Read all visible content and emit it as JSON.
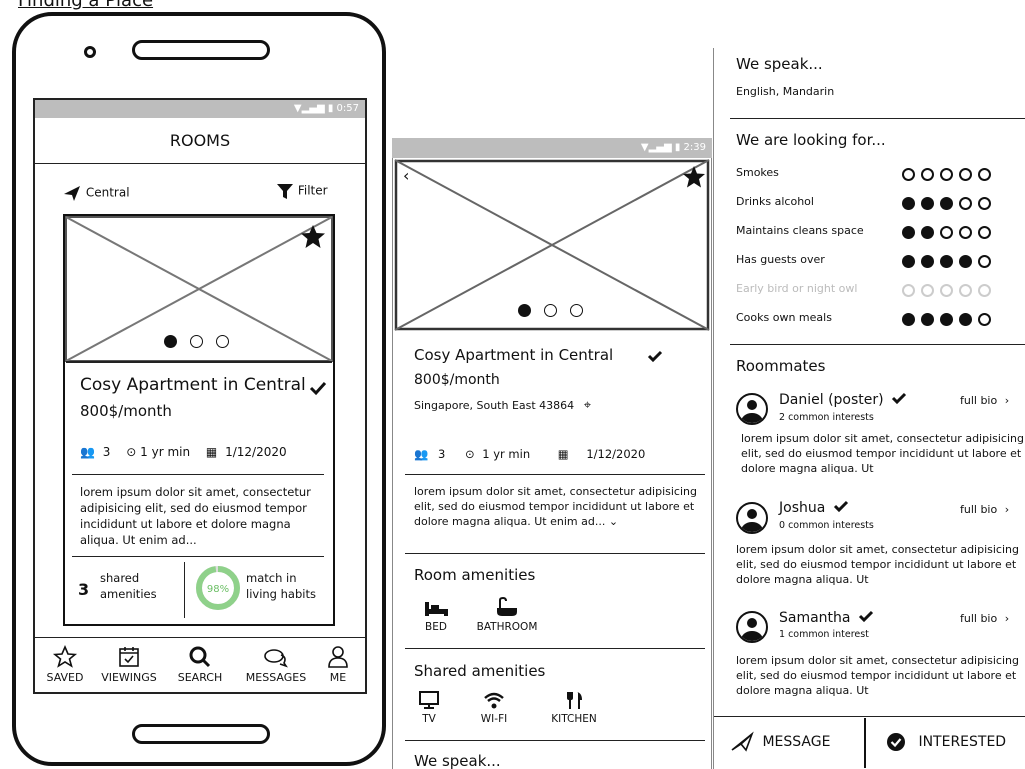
{
  "page_title": "Finding a Place",
  "phone1": {
    "status_time": "0:57",
    "header_title": "ROOMS",
    "location_label": "Central",
    "filter_label": "Filter",
    "card": {
      "title": "Cosy Apartment in Central",
      "price": "800$/month",
      "people": "3",
      "duration": "1 yr min",
      "date": "1/12/2020",
      "description": "lorem ipsum dolor sit amet, consectetur adipisicing elit, sed do eiusmod tempor incididunt ut labore et dolore magna aliqua. Ut enim ad...",
      "shared_count": "3",
      "shared_label_1": "shared",
      "shared_label_2": "amenities",
      "match_percent": "98%",
      "match_value": 0.98,
      "match_label_1": "match in",
      "match_label_2": "living habits"
    },
    "nav": [
      {
        "label": "SAVED",
        "icon": "star-outline-icon"
      },
      {
        "label": "VIEWINGS",
        "icon": "calendar-check-icon"
      },
      {
        "label": "SEARCH",
        "icon": "search-icon"
      },
      {
        "label": "MESSAGES",
        "icon": "chat-icon"
      },
      {
        "label": "ME",
        "icon": "person-icon"
      }
    ]
  },
  "detail": {
    "status_time": "2:39",
    "title": "Cosy Apartment in Central",
    "price": "800$/month",
    "address": "Singapore, South East 43864",
    "people": "3",
    "duration": "1 yr min",
    "date": "1/12/2020",
    "description": "lorem ipsum dolor sit amet, consectetur adipisicing elit, sed do eiusmod tempor incididunt ut labore et dolore magna aliqua. Ut enim ad...",
    "room_amenities_title": "Room amenities",
    "room_amenities": [
      {
        "label": "BED",
        "icon": "bed-icon"
      },
      {
        "label": "BATHROOM",
        "icon": "bathtub-icon"
      }
    ],
    "shared_amenities_title": "Shared amenities",
    "shared_amenities": [
      {
        "label": "TV",
        "icon": "monitor-icon"
      },
      {
        "label": "WI-FI",
        "icon": "wifi-icon"
      },
      {
        "label": "KITCHEN",
        "icon": "cutlery-icon"
      }
    ],
    "we_speak_title": "We speak..."
  },
  "right": {
    "we_speak_title": "We speak...",
    "languages": "English, Mandarin",
    "looking_for_title": "We are looking for...",
    "traits": [
      {
        "label": "Smokes",
        "level": 0,
        "faded": false
      },
      {
        "label": "Drinks alcohol",
        "level": 3,
        "faded": false
      },
      {
        "label": "Maintains cleans space",
        "level": 2,
        "faded": false
      },
      {
        "label": "Has guests over",
        "level": 4,
        "faded": false
      },
      {
        "label": "Early bird or night owl",
        "level": 0,
        "faded": true
      },
      {
        "label": "Cooks own meals",
        "level": 4,
        "faded": false
      }
    ],
    "roommates_title": "Roommates",
    "full_bio": "full bio",
    "roommates": [
      {
        "name": "Daniel (poster)",
        "interests": "2 common interests",
        "bio": "lorem ipsum dolor sit amet, consectetur adipisicing elit, sed do eiusmod tempor incididunt ut labore et dolore magna aliqua. Ut"
      },
      {
        "name": "Joshua",
        "interests": "0 common interests",
        "bio": "lorem ipsum dolor sit amet, consectetur adipisicing elit, sed do eiusmod tempor incididunt ut labore et dolore magna aliqua. Ut"
      },
      {
        "name": "Samantha",
        "interests": "1 common interest",
        "bio": "lorem ipsum dolor sit amet, consectetur adipisicing elit, sed do eiusmod tempor incididunt ut labore et dolore magna aliqua. Ut"
      }
    ],
    "message_label": "MESSAGE",
    "interested_label": "INTERESTED"
  }
}
